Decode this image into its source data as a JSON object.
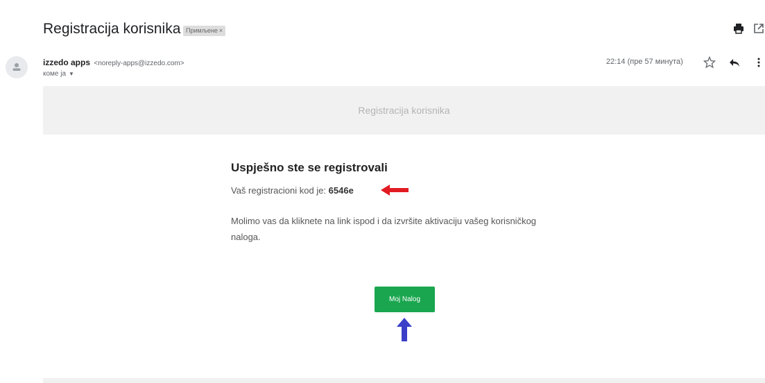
{
  "header": {
    "subject": "Registracija korisnika",
    "label": "Примљене",
    "label_close": "×"
  },
  "message": {
    "sender_name": "izzedo apps",
    "sender_email": "<noreply-apps@izzedo.com>",
    "recipient": "коме ја",
    "time": "22:14 (пре 57 минута)"
  },
  "email_body": {
    "banner_title": "Registracija korisnika",
    "heading": "Uspješno ste se registrovali",
    "code_label": "Vaš registracioni kod je:",
    "code": "6546e",
    "paragraph": "Molimo vas da kliknete na link ispod i da izvršite aktivaciju vašeg korisničkog naloga.",
    "button_label": "Moj Nalog"
  },
  "icons": {
    "print": "print-icon",
    "new_window": "open-in-new-window-icon",
    "avatar": "person-avatar-icon",
    "star": "star-icon",
    "reply": "reply-icon",
    "more": "more-vertical-icon",
    "dropdown": "chevron-down-icon",
    "annotation_red": "red-arrow-icon",
    "annotation_blue": "blue-arrow-icon"
  },
  "colors": {
    "button": "#1aa64f",
    "banner_bg": "#f1f1f1",
    "red_arrow": "#e11b22",
    "blue_arrow": "#3b3fc8"
  }
}
